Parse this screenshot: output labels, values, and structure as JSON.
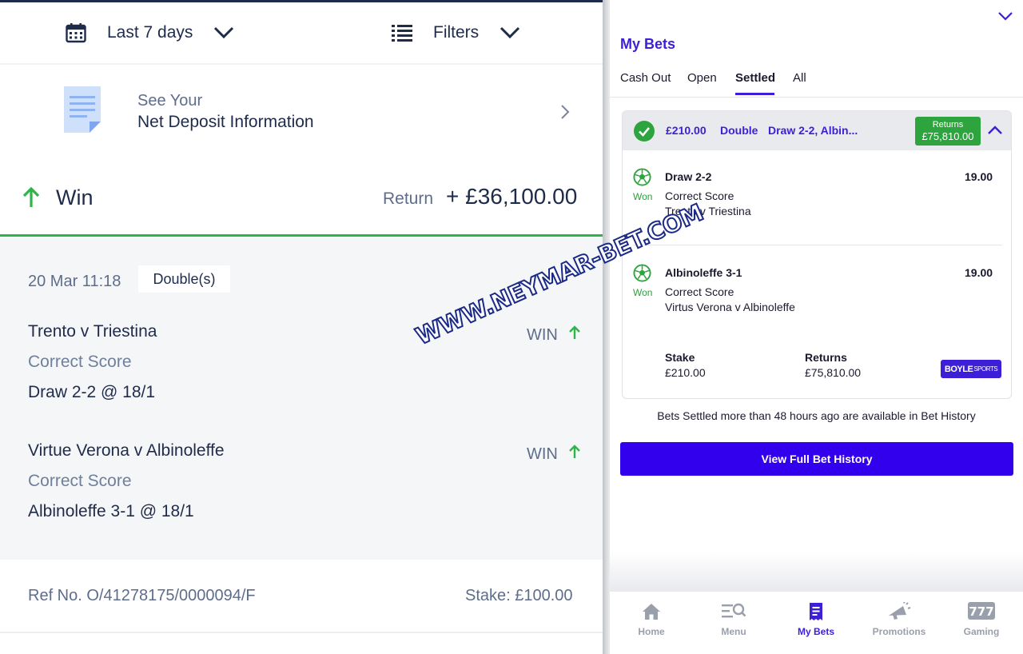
{
  "left": {
    "date_filter": "Last 7 days",
    "filters_label": "Filters",
    "deposit": {
      "line1": "See Your",
      "line2": "Net Deposit Information"
    },
    "result": {
      "label": "Win",
      "return_label": "Return",
      "return_value": "+ £36,100.00"
    },
    "bet": {
      "datetime": "20 Mar 11:18",
      "type_badge": "Double(s)",
      "legs": [
        {
          "match": "Trento v Triestina",
          "market": "Correct Score",
          "selection": "Draw 2-2 @ 18/1",
          "result": "WIN"
        },
        {
          "match": "Virtue Verona v Albinoleffe",
          "market": "Correct Score",
          "selection": "Albinoleffe 3-1 @ 18/1",
          "result": "WIN"
        }
      ]
    },
    "ref": "Ref No. O/41278175/0000094/F",
    "stake": "Stake: £100.00"
  },
  "right": {
    "title": "My Bets",
    "tabs": [
      "Cash Out",
      "Open",
      "Settled",
      "All"
    ],
    "active_tab": "Settled",
    "card": {
      "amount": "£210.00",
      "bet_type": "Double",
      "bet_name": "Draw 2-2, Albin...",
      "returns_label": "Returns",
      "returns_value": "£75,810.00",
      "legs": [
        {
          "status": "Won",
          "name": "Draw 2-2",
          "odds": "19.00",
          "market": "Correct Score",
          "event": "Trento v Triestina"
        },
        {
          "status": "Won",
          "name": "Albinoleffe 3-1",
          "odds": "19.00",
          "market": "Correct Score",
          "event": "Virtus Verona v Albinoleffe"
        }
      ],
      "stake_label": "Stake",
      "stake_value": "£210.00",
      "returns_total_label": "Returns",
      "returns_total_value": "£75,810.00",
      "brand_main": "BOYLE",
      "brand_sub": "SPORTS"
    },
    "history_note": "Bets Settled more than 48 hours ago are available in Bet History",
    "history_button": "View Full Bet History",
    "nav": [
      {
        "label": "Home",
        "icon": "home-icon"
      },
      {
        "label": "Menu",
        "icon": "menu-search-icon"
      },
      {
        "label": "My Bets",
        "icon": "bet-slip-icon"
      },
      {
        "label": "Promotions",
        "icon": "megaphone-icon"
      },
      {
        "label": "Gaming",
        "icon": "slot-777-icon"
      }
    ],
    "active_nav": "My Bets"
  },
  "watermark": "WWW.NEYMAR-BET.COM",
  "colors": {
    "brand_blue": "#3c1fd6",
    "button_blue": "#3300ee",
    "win_green": "#2fb44a",
    "navy_text": "#1f2b4a"
  }
}
